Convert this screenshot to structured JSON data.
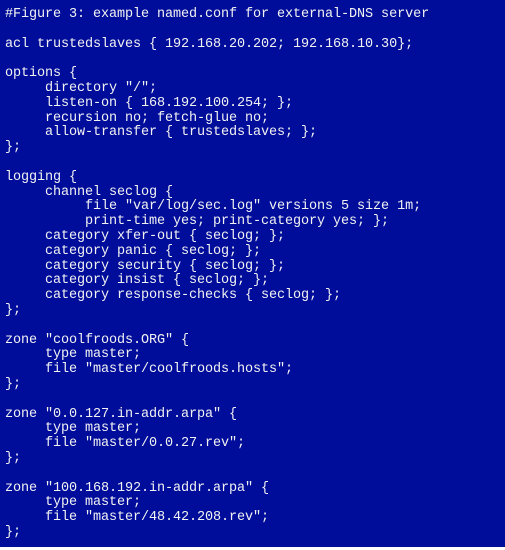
{
  "colors": {
    "background": "#000c9a",
    "text": "#f2f2f2"
  },
  "code": {
    "lines": [
      "#Figure 3: example named.conf for external-DNS server",
      "",
      "acl trustedslaves { 192.168.20.202; 192.168.10.30};",
      "",
      "options {",
      "     directory \"/\";",
      "     listen-on { 168.192.100.254; };",
      "     recursion no; fetch-glue no;",
      "     allow-transfer { trustedslaves; };",
      "};",
      "",
      "logging {",
      "     channel seclog {",
      "          file \"var/log/sec.log\" versions 5 size 1m;",
      "          print-time yes; print-category yes; };",
      "     category xfer-out { seclog; };",
      "     category panic { seclog; };",
      "     category security { seclog; };",
      "     category insist { seclog; };",
      "     category response-checks { seclog; };",
      "};",
      "",
      "zone \"coolfroods.ORG\" {",
      "     type master;",
      "     file \"master/coolfroods.hosts\";",
      "};",
      "",
      "zone \"0.0.127.in-addr.arpa\" {",
      "     type master;",
      "     file \"master/0.0.27.rev\";",
      "};",
      "",
      "zone \"100.168.192.in-addr.arpa\" {",
      "     type master;",
      "     file \"master/48.42.208.rev\";",
      "};"
    ]
  }
}
